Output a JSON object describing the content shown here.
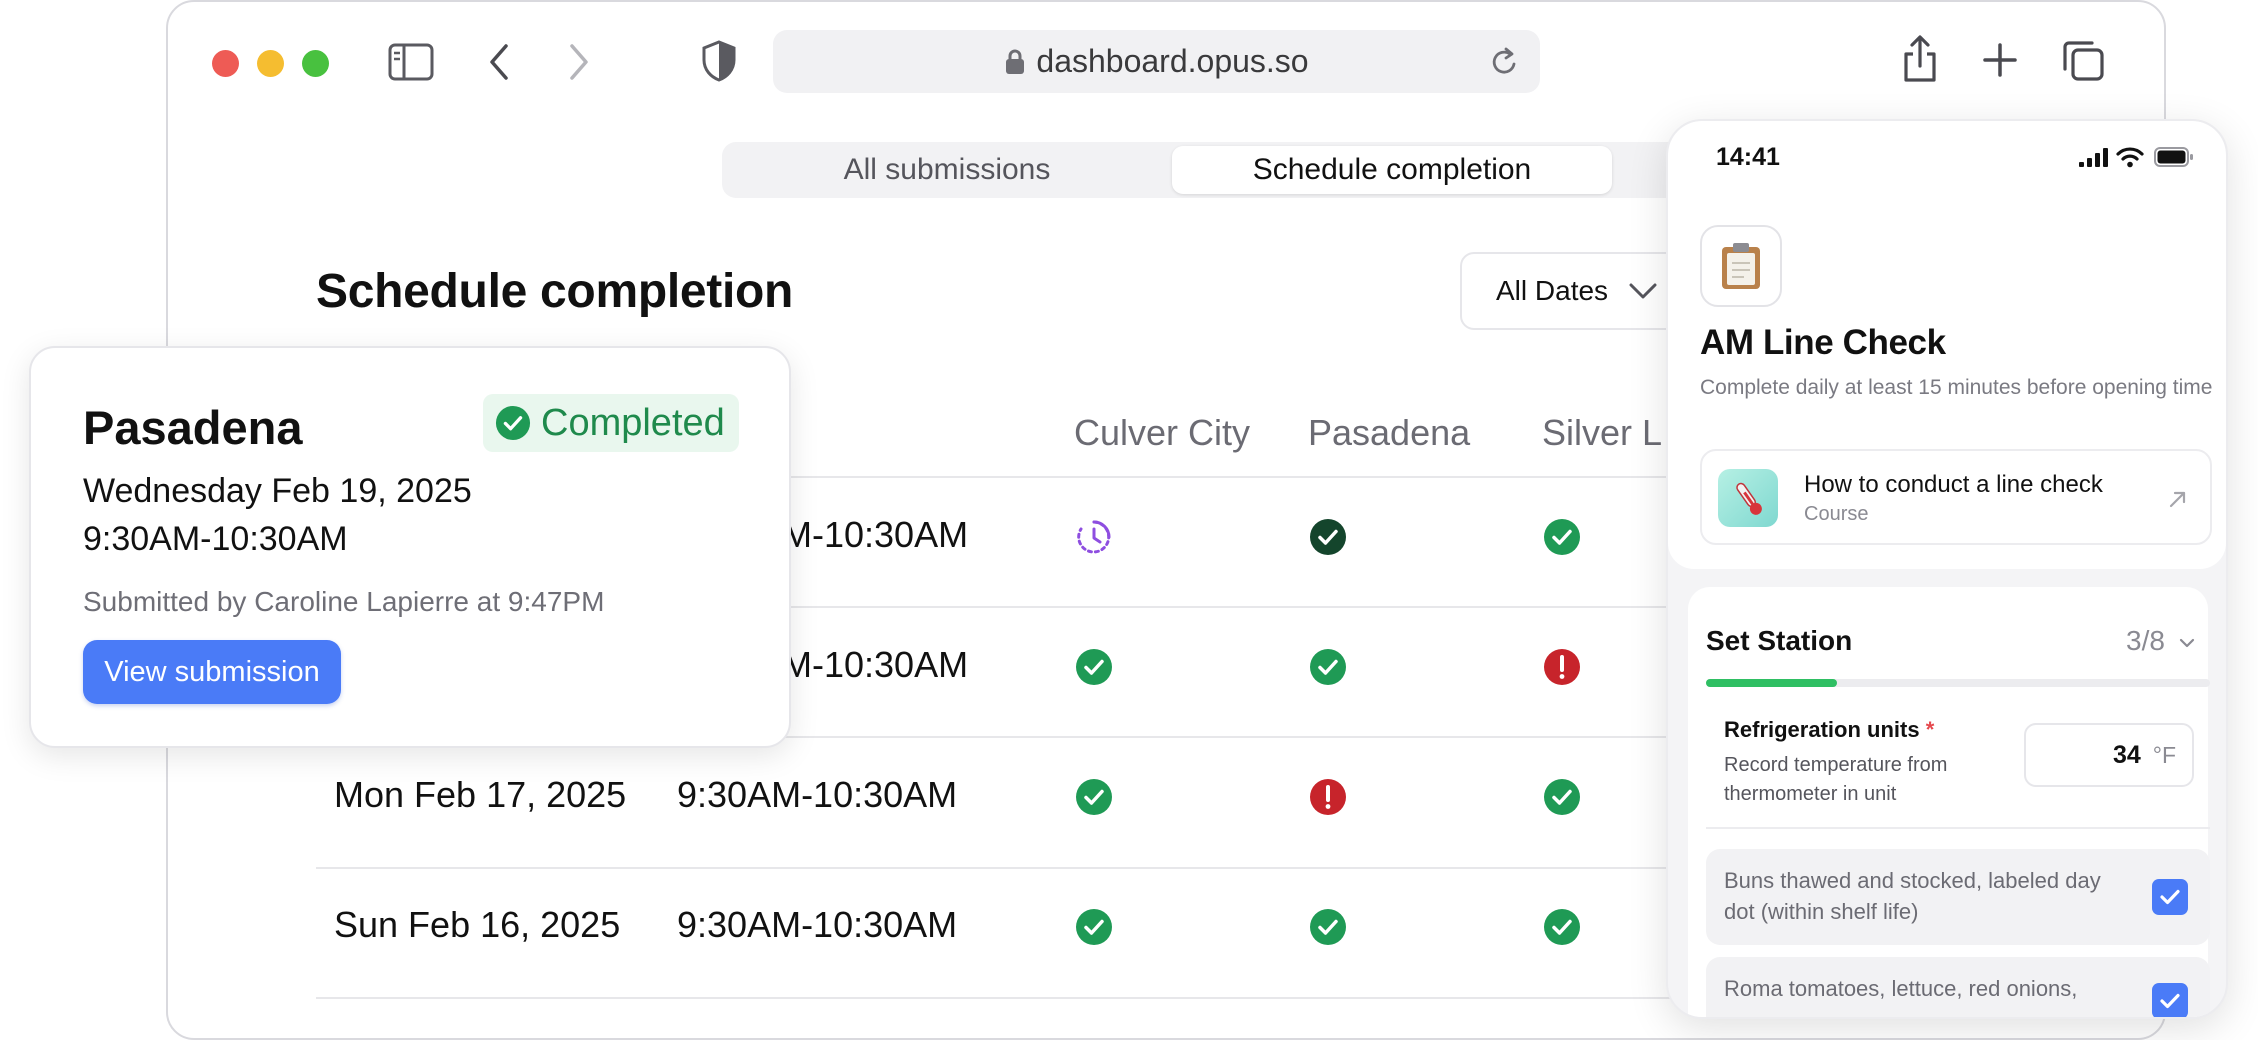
{
  "browser": {
    "url": "dashboard.opus.so",
    "tabs": [
      {
        "label": "All submissions",
        "active": false
      },
      {
        "label": "Schedule completion",
        "active": true
      }
    ]
  },
  "page": {
    "title": "Schedule completion",
    "date_filter": "All Dates"
  },
  "table": {
    "columns": [
      "Culver City",
      "Pasadena",
      "Silver L"
    ],
    "rows": [
      {
        "date": "",
        "time": "M-10:30AM",
        "statuses": [
          "pending",
          "completed-dark",
          "completed"
        ]
      },
      {
        "date": "",
        "time": "M-10:30AM",
        "statuses": [
          "completed",
          "completed",
          "missed"
        ]
      },
      {
        "date": "Mon Feb 17, 2025",
        "time": "9:30AM-10:30AM",
        "statuses": [
          "completed",
          "missed",
          "completed"
        ]
      },
      {
        "date": "Sun Feb 16, 2025",
        "time": "9:30AM-10:30AM",
        "statuses": [
          "completed",
          "completed",
          "completed"
        ]
      }
    ]
  },
  "popover": {
    "location": "Pasadena",
    "badge": "Completed",
    "date": "Wednesday Feb 19, 2025",
    "time": "9:30AM-10:30AM",
    "submitted": "Submitted by Caroline Lapierre at 9:47PM",
    "button": "View submission"
  },
  "phone": {
    "clock": "14:41",
    "checklist_title": "AM Line Check",
    "checklist_desc": "Complete daily at least 15 minutes before opening time",
    "course": {
      "title": "How to conduct a line check",
      "type": "Course"
    },
    "section": {
      "title": "Set Station",
      "count": "3/8",
      "progress": 0.26
    },
    "field": {
      "label": "Refrigeration units",
      "required_mark": "*",
      "help": "Record temperature from thermometer in unit",
      "value": "34",
      "unit": "°F"
    },
    "checks": [
      {
        "text": "Buns thawed and stocked, labeled day dot (within shelf life)",
        "checked": true
      },
      {
        "text": "Roma tomatoes, lettuce, red onions,",
        "checked": true
      }
    ]
  },
  "colors": {
    "accent": "#4a7bf7",
    "success": "#1f9a55",
    "success_dark": "#14452c",
    "danger": "#c7242b",
    "pending": "#8e4ee0",
    "progress": "#2fbf63"
  }
}
